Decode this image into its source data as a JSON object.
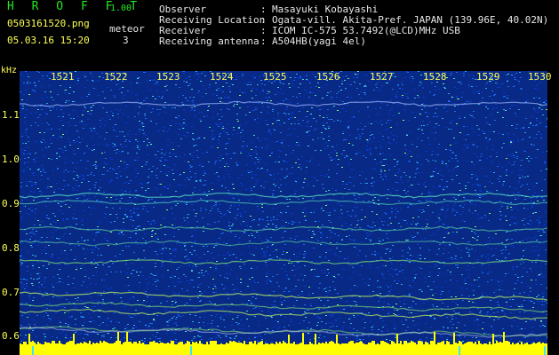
{
  "header": {
    "app_title": "H R O F F T",
    "version": "1.00",
    "filename": "0503161520.png",
    "datetime": "05.03.16 15:20",
    "meteor_label": "meteor",
    "meteor_count": "3",
    "info": [
      {
        "key": "Observer",
        "value": "Masayuki Kobayashi"
      },
      {
        "key": "Receiving Location",
        "value": "Ogata-vill. Akita-Pref. JAPAN (139.96E, 40.02N)"
      },
      {
        "key": "Receiver",
        "value": "ICOM IC-575 53.7492(@LCD)MHz USB"
      },
      {
        "key": "Receiving antenna",
        "value": "A504HB(yagi 4el)"
      }
    ]
  },
  "plot": {
    "y_unit": "kHz",
    "time_ticks": [
      "1521",
      "1522",
      "1523",
      "1524",
      "1525",
      "1526",
      "1527",
      "1528",
      "1529",
      "1530"
    ],
    "freq_ticks": [
      "1.1",
      "1.0",
      "0.9",
      "0.8",
      "0.7",
      "0.6"
    ],
    "colors": {
      "background": "#082a86",
      "noise": [
        "#0a3bd6",
        "#1c6cf0",
        "#2fa8e8",
        "#48d8c8",
        "#8cf070"
      ],
      "label": "#ffff55",
      "title": "#22e822",
      "baseline": "#ffff00"
    }
  }
}
